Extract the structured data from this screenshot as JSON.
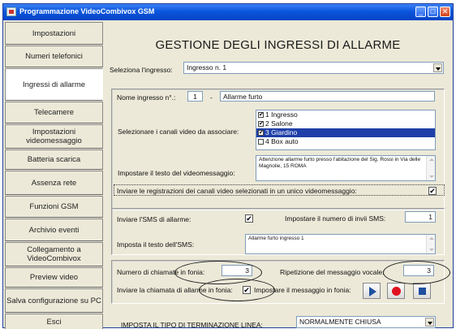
{
  "window": {
    "title": "Programmazione VideoCombivox GSM",
    "controls": {
      "minimize": "_",
      "maximize": "□",
      "close": "✕"
    }
  },
  "sidebar": {
    "items": [
      {
        "label": "Impostazioni"
      },
      {
        "label": "Numeri telefonici"
      },
      {
        "label": "Ingressi di allarme"
      },
      {
        "label": "Telecamere"
      },
      {
        "label": "Impostazioni videomessaggio"
      },
      {
        "label": "Batteria scarica"
      },
      {
        "label": "Assenza rete"
      },
      {
        "label": "Funzioni GSM"
      },
      {
        "label": "Archivio eventi"
      },
      {
        "label": "Collegamento a VideoCombivox"
      },
      {
        "label": "Preview video"
      },
      {
        "label": "Salva configurazione su PC"
      },
      {
        "label": "Esci"
      }
    ],
    "active_index": 2
  },
  "main": {
    "heading": "GESTIONE DEGLI INGRESSI DI ALLARME",
    "select_input": {
      "label": "Seleziona l'ingresso:",
      "value": "Ingresso n. 1"
    },
    "input_name": {
      "label": "Nome ingresso n°.:",
      "number": "1",
      "dash": "-",
      "value": "Allarme furto"
    },
    "video_channels": {
      "label": "Selezionare i canali video da associare:",
      "items": [
        {
          "label": "1 Ingresso",
          "checked": true,
          "selected": false
        },
        {
          "label": "2 Salone",
          "checked": true,
          "selected": false
        },
        {
          "label": "3 Giardino",
          "checked": true,
          "selected": true
        },
        {
          "label": "4 Box auto",
          "checked": false,
          "selected": false
        }
      ]
    },
    "video_message": {
      "label": "Impostare il testo del videomessaggio:",
      "text": "Attenzione allarme furto presso l'abitazione del Sig. Rossi in Via delle Magnolie, 15 ROMA"
    },
    "single_video": {
      "label": "Inviare le registrazioni dei canali video selezionati in un unico videomessaggio:",
      "checked": true
    },
    "sms": {
      "send_label": "Inviare l'SMS di allarme:",
      "send_checked": true,
      "count_label": "Impostare il numero di invii SMS:",
      "count_value": "1",
      "text_label": "Imposta il testo dell'SMS:",
      "text_value": "Allarme furto ingresso 1"
    },
    "voice": {
      "calls_label": "Numero di chiamate in fonia:",
      "calls_value": "3",
      "repeat_label": "Ripetizione del messaggio vocale:",
      "repeat_value": "3",
      "send_call_label": "Inviare la chiamata di allarme in fonia:",
      "send_call_checked": true,
      "set_message_label": "Impostare il messaggio in fonia:"
    },
    "termination": {
      "label": "IMPOSTA IL TIPO DI TERMINAZIONE LINEA:",
      "value": "NORMALMENTE CHIUSA"
    }
  },
  "icons": [
    "app-icon",
    "minimize-icon",
    "maximize-icon",
    "close-icon",
    "dropdown-arrow-icon",
    "play-icon",
    "record-icon",
    "stop-icon"
  ],
  "colors": {
    "titlebar": "#0a56dc",
    "selection": "#1f3fa8",
    "record": "#e01020",
    "media_blue": "#1d4f9e",
    "window_bg": "#ece9d8"
  }
}
